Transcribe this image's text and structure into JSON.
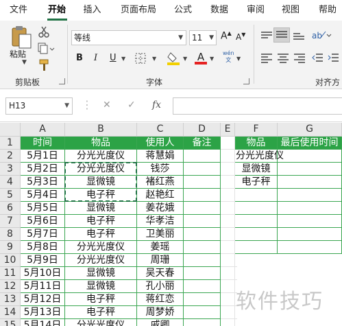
{
  "ribbon_tabs": [
    "文件",
    "开始",
    "插入",
    "页面布局",
    "公式",
    "数据",
    "审阅",
    "视图",
    "帮助"
  ],
  "active_tab": "开始",
  "clipboard": {
    "paste_label": "粘贴",
    "group_label": "剪贴板"
  },
  "font": {
    "name": "等线",
    "size": "11",
    "group_label": "字体",
    "phonetic_label": "wén\n文"
  },
  "alignment": {
    "group_label": "对齐方"
  },
  "formula_bar": {
    "name_box": "H13",
    "fx_label": "fx",
    "formula": ""
  },
  "colors": {
    "accent": "#217346",
    "header_fill": "#2ca346",
    "font_color": "#e52222",
    "fill_color": "#f2d000"
  },
  "columns": [
    "A",
    "B",
    "C",
    "D",
    "E",
    "F",
    "G"
  ],
  "rows": [
    "1",
    "2",
    "3",
    "4",
    "5",
    "6",
    "7",
    "8",
    "9",
    "10",
    "11",
    "12",
    "13",
    "14",
    "15"
  ],
  "sheet": {
    "main_headers": [
      "时间",
      "物品",
      "使用人",
      "备注"
    ],
    "main_rows": [
      [
        "5月1日",
        "分光光度仪",
        "蒋慧娟",
        ""
      ],
      [
        "5月2日",
        "分光光度仪",
        "钱莎",
        ""
      ],
      [
        "5月3日",
        "显微镜",
        "褚红燕",
        ""
      ],
      [
        "5月4日",
        "电子秤",
        "赵艳红",
        ""
      ],
      [
        "5月5日",
        "显微镜",
        "姜花娥",
        ""
      ],
      [
        "5月6日",
        "电子秤",
        "华孝洁",
        ""
      ],
      [
        "5月7日",
        "电子秤",
        "卫美丽",
        ""
      ],
      [
        "5月8日",
        "分光光度仪",
        "姜瑶",
        ""
      ],
      [
        "5月9日",
        "分光光度仪",
        "周珊",
        ""
      ],
      [
        "5月10日",
        "显微镜",
        "吴天春",
        ""
      ],
      [
        "5月11日",
        "显微镜",
        "孔小丽",
        ""
      ],
      [
        "5月12日",
        "电子秤",
        "蒋红恋",
        ""
      ],
      [
        "5月13日",
        "电子秤",
        "周梦娇",
        ""
      ],
      [
        "5月14日",
        "分光光度仪",
        "戚卿",
        ""
      ]
    ],
    "side_headers": [
      "物品",
      "最后使用时间"
    ],
    "side_rows": [
      [
        "分光光度仪",
        ""
      ],
      [
        "显微镜",
        ""
      ],
      [
        "电子秤",
        ""
      ],
      [
        "",
        ""
      ],
      [
        "",
        ""
      ],
      [
        "",
        ""
      ],
      [
        "",
        ""
      ],
      [
        "",
        ""
      ]
    ]
  },
  "watermark": "软件技巧"
}
